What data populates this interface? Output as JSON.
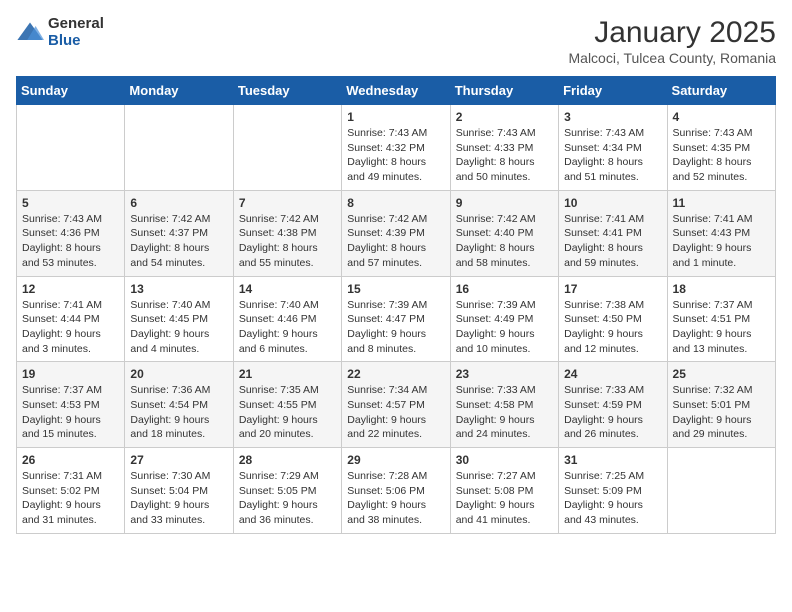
{
  "header": {
    "logo_general": "General",
    "logo_blue": "Blue",
    "month": "January 2025",
    "location": "Malcoci, Tulcea County, Romania"
  },
  "days_of_week": [
    "Sunday",
    "Monday",
    "Tuesday",
    "Wednesday",
    "Thursday",
    "Friday",
    "Saturday"
  ],
  "weeks": [
    [
      {
        "day": "",
        "info": ""
      },
      {
        "day": "",
        "info": ""
      },
      {
        "day": "",
        "info": ""
      },
      {
        "day": "1",
        "info": "Sunrise: 7:43 AM\nSunset: 4:32 PM\nDaylight: 8 hours and 49 minutes."
      },
      {
        "day": "2",
        "info": "Sunrise: 7:43 AM\nSunset: 4:33 PM\nDaylight: 8 hours and 50 minutes."
      },
      {
        "day": "3",
        "info": "Sunrise: 7:43 AM\nSunset: 4:34 PM\nDaylight: 8 hours and 51 minutes."
      },
      {
        "day": "4",
        "info": "Sunrise: 7:43 AM\nSunset: 4:35 PM\nDaylight: 8 hours and 52 minutes."
      }
    ],
    [
      {
        "day": "5",
        "info": "Sunrise: 7:43 AM\nSunset: 4:36 PM\nDaylight: 8 hours and 53 minutes."
      },
      {
        "day": "6",
        "info": "Sunrise: 7:42 AM\nSunset: 4:37 PM\nDaylight: 8 hours and 54 minutes."
      },
      {
        "day": "7",
        "info": "Sunrise: 7:42 AM\nSunset: 4:38 PM\nDaylight: 8 hours and 55 minutes."
      },
      {
        "day": "8",
        "info": "Sunrise: 7:42 AM\nSunset: 4:39 PM\nDaylight: 8 hours and 57 minutes."
      },
      {
        "day": "9",
        "info": "Sunrise: 7:42 AM\nSunset: 4:40 PM\nDaylight: 8 hours and 58 minutes."
      },
      {
        "day": "10",
        "info": "Sunrise: 7:41 AM\nSunset: 4:41 PM\nDaylight: 8 hours and 59 minutes."
      },
      {
        "day": "11",
        "info": "Sunrise: 7:41 AM\nSunset: 4:43 PM\nDaylight: 9 hours and 1 minute."
      }
    ],
    [
      {
        "day": "12",
        "info": "Sunrise: 7:41 AM\nSunset: 4:44 PM\nDaylight: 9 hours and 3 minutes."
      },
      {
        "day": "13",
        "info": "Sunrise: 7:40 AM\nSunset: 4:45 PM\nDaylight: 9 hours and 4 minutes."
      },
      {
        "day": "14",
        "info": "Sunrise: 7:40 AM\nSunset: 4:46 PM\nDaylight: 9 hours and 6 minutes."
      },
      {
        "day": "15",
        "info": "Sunrise: 7:39 AM\nSunset: 4:47 PM\nDaylight: 9 hours and 8 minutes."
      },
      {
        "day": "16",
        "info": "Sunrise: 7:39 AM\nSunset: 4:49 PM\nDaylight: 9 hours and 10 minutes."
      },
      {
        "day": "17",
        "info": "Sunrise: 7:38 AM\nSunset: 4:50 PM\nDaylight: 9 hours and 12 minutes."
      },
      {
        "day": "18",
        "info": "Sunrise: 7:37 AM\nSunset: 4:51 PM\nDaylight: 9 hours and 13 minutes."
      }
    ],
    [
      {
        "day": "19",
        "info": "Sunrise: 7:37 AM\nSunset: 4:53 PM\nDaylight: 9 hours and 15 minutes."
      },
      {
        "day": "20",
        "info": "Sunrise: 7:36 AM\nSunset: 4:54 PM\nDaylight: 9 hours and 18 minutes."
      },
      {
        "day": "21",
        "info": "Sunrise: 7:35 AM\nSunset: 4:55 PM\nDaylight: 9 hours and 20 minutes."
      },
      {
        "day": "22",
        "info": "Sunrise: 7:34 AM\nSunset: 4:57 PM\nDaylight: 9 hours and 22 minutes."
      },
      {
        "day": "23",
        "info": "Sunrise: 7:33 AM\nSunset: 4:58 PM\nDaylight: 9 hours and 24 minutes."
      },
      {
        "day": "24",
        "info": "Sunrise: 7:33 AM\nSunset: 4:59 PM\nDaylight: 9 hours and 26 minutes."
      },
      {
        "day": "25",
        "info": "Sunrise: 7:32 AM\nSunset: 5:01 PM\nDaylight: 9 hours and 29 minutes."
      }
    ],
    [
      {
        "day": "26",
        "info": "Sunrise: 7:31 AM\nSunset: 5:02 PM\nDaylight: 9 hours and 31 minutes."
      },
      {
        "day": "27",
        "info": "Sunrise: 7:30 AM\nSunset: 5:04 PM\nDaylight: 9 hours and 33 minutes."
      },
      {
        "day": "28",
        "info": "Sunrise: 7:29 AM\nSunset: 5:05 PM\nDaylight: 9 hours and 36 minutes."
      },
      {
        "day": "29",
        "info": "Sunrise: 7:28 AM\nSunset: 5:06 PM\nDaylight: 9 hours and 38 minutes."
      },
      {
        "day": "30",
        "info": "Sunrise: 7:27 AM\nSunset: 5:08 PM\nDaylight: 9 hours and 41 minutes."
      },
      {
        "day": "31",
        "info": "Sunrise: 7:25 AM\nSunset: 5:09 PM\nDaylight: 9 hours and 43 minutes."
      },
      {
        "day": "",
        "info": ""
      }
    ]
  ]
}
